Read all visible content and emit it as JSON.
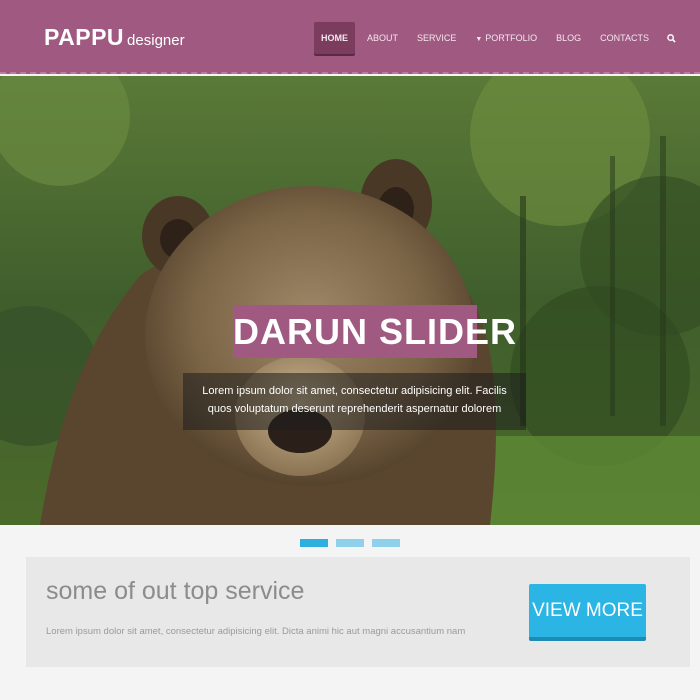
{
  "header": {
    "logo_main": "PAPPU",
    "logo_sub": "designer",
    "brand_color": "#a05a82",
    "nav": [
      {
        "label": "HOME",
        "active": true
      },
      {
        "label": "ABOUT"
      },
      {
        "label": "SERVICE"
      },
      {
        "label": "PORTFOLIO",
        "has_caret": true
      },
      {
        "label": "BLOG"
      },
      {
        "label": "CONTACTS"
      }
    ],
    "search_icon": "search-icon"
  },
  "hero": {
    "title": "DARUN SLIDER",
    "caption": "Lorem ipsum dolor sit amet, consectetur adipisicing elit. Facilis quos voluptatum deserunt reprehenderit aspernatur dolorem",
    "image": "brown bear in forest"
  },
  "slider_dots": {
    "count": 3,
    "active_index": 0,
    "active_color": "#2db0de",
    "inactive_color": "#8fd0ea"
  },
  "service": {
    "title": "some of out top service",
    "text": "Lorem ipsum dolor sit amet, consectetur adipisicing elit. Dicta animi hic aut magni accusantium nam",
    "button_label": "VIEW MORE",
    "button_color": "#2bb5e4"
  }
}
